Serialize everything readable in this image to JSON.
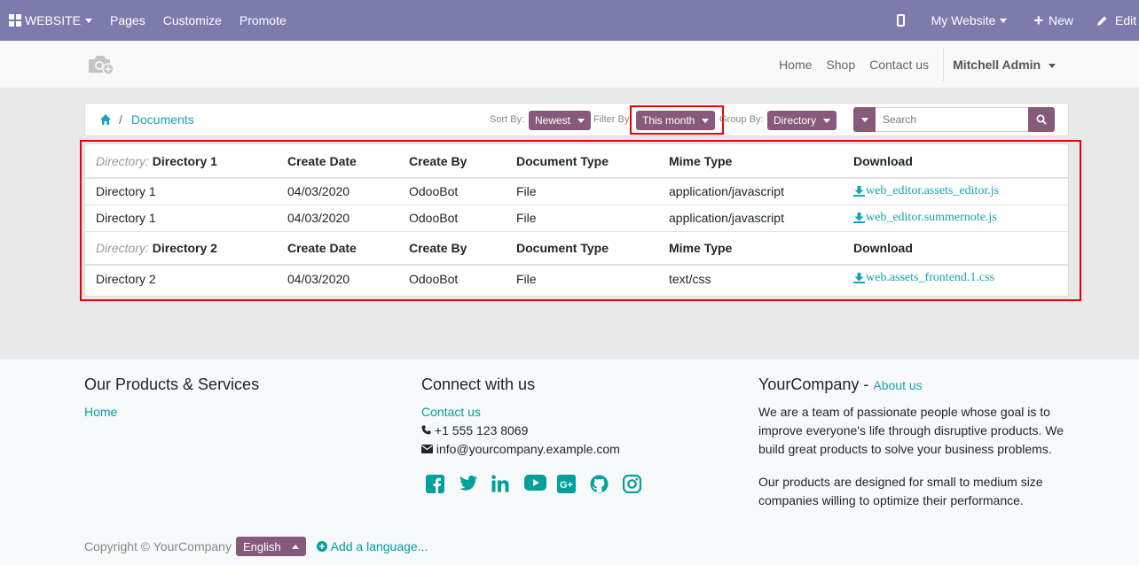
{
  "topbar": {
    "website_label": "WEBSITE",
    "pages": "Pages",
    "customize": "Customize",
    "promote": "Promote",
    "my_website": "My Website",
    "new": "New",
    "edit": "Edit"
  },
  "header": {
    "nav": [
      "Home",
      "Shop",
      "Contact us"
    ],
    "user": "Mitchell Admin"
  },
  "toolbar": {
    "breadcrumb_current": "Documents",
    "sort_label": "Sort By:",
    "sort_value": "Newest",
    "filter_label": "Filter By:",
    "filter_value": "This month",
    "group_label": "Group By:",
    "group_value": "Directory",
    "search_placeholder": "Search"
  },
  "table": {
    "dir_key": "Directory:",
    "columns": [
      "Create Date",
      "Create By",
      "Document Type",
      "Mime Type",
      "Download"
    ],
    "groups": [
      {
        "name": "Directory 1",
        "rows": [
          [
            "Directory 1",
            "04/03/2020",
            "OdooBot",
            "File",
            "application/javascript",
            "web_editor.assets_editor.js"
          ],
          [
            "Directory 1",
            "04/03/2020",
            "OdooBot",
            "File",
            "application/javascript",
            "web_editor.summernote.js"
          ]
        ]
      },
      {
        "name": "Directory 2",
        "rows": [
          [
            "Directory 2",
            "04/03/2020",
            "OdooBot",
            "File",
            "text/css",
            "web.assets_frontend.1.css"
          ]
        ]
      }
    ]
  },
  "footer": {
    "products_title": "Our Products & Services",
    "products_home": "Home",
    "connect_title": "Connect with us",
    "contact_link": "Contact us",
    "phone": "+1 555 123 8069",
    "email": "info@yourcompany.example.com",
    "company_name": "YourCompany",
    "company_sep": " - ",
    "about_link": "About us",
    "about_p1": "We are a team of passionate people whose goal is to improve everyone's life through disruptive products. We build great products to solve your business problems.",
    "about_p2": "Our products are designed for small to medium size companies willing to optimize their performance.",
    "copyright": "Copyright © YourCompany",
    "language": "English",
    "add_language": "Add a language...",
    "social_icons": [
      "facebook-icon",
      "twitter-icon",
      "linkedin-icon",
      "youtube-icon",
      "google-plus-icon",
      "github-icon",
      "instagram-icon"
    ]
  },
  "colors": {
    "topbar": "#7c7bad",
    "brand": "#875A7B",
    "link": "#17a2b8",
    "footer_link": "#00A09D",
    "highlight": "#ee0000"
  }
}
